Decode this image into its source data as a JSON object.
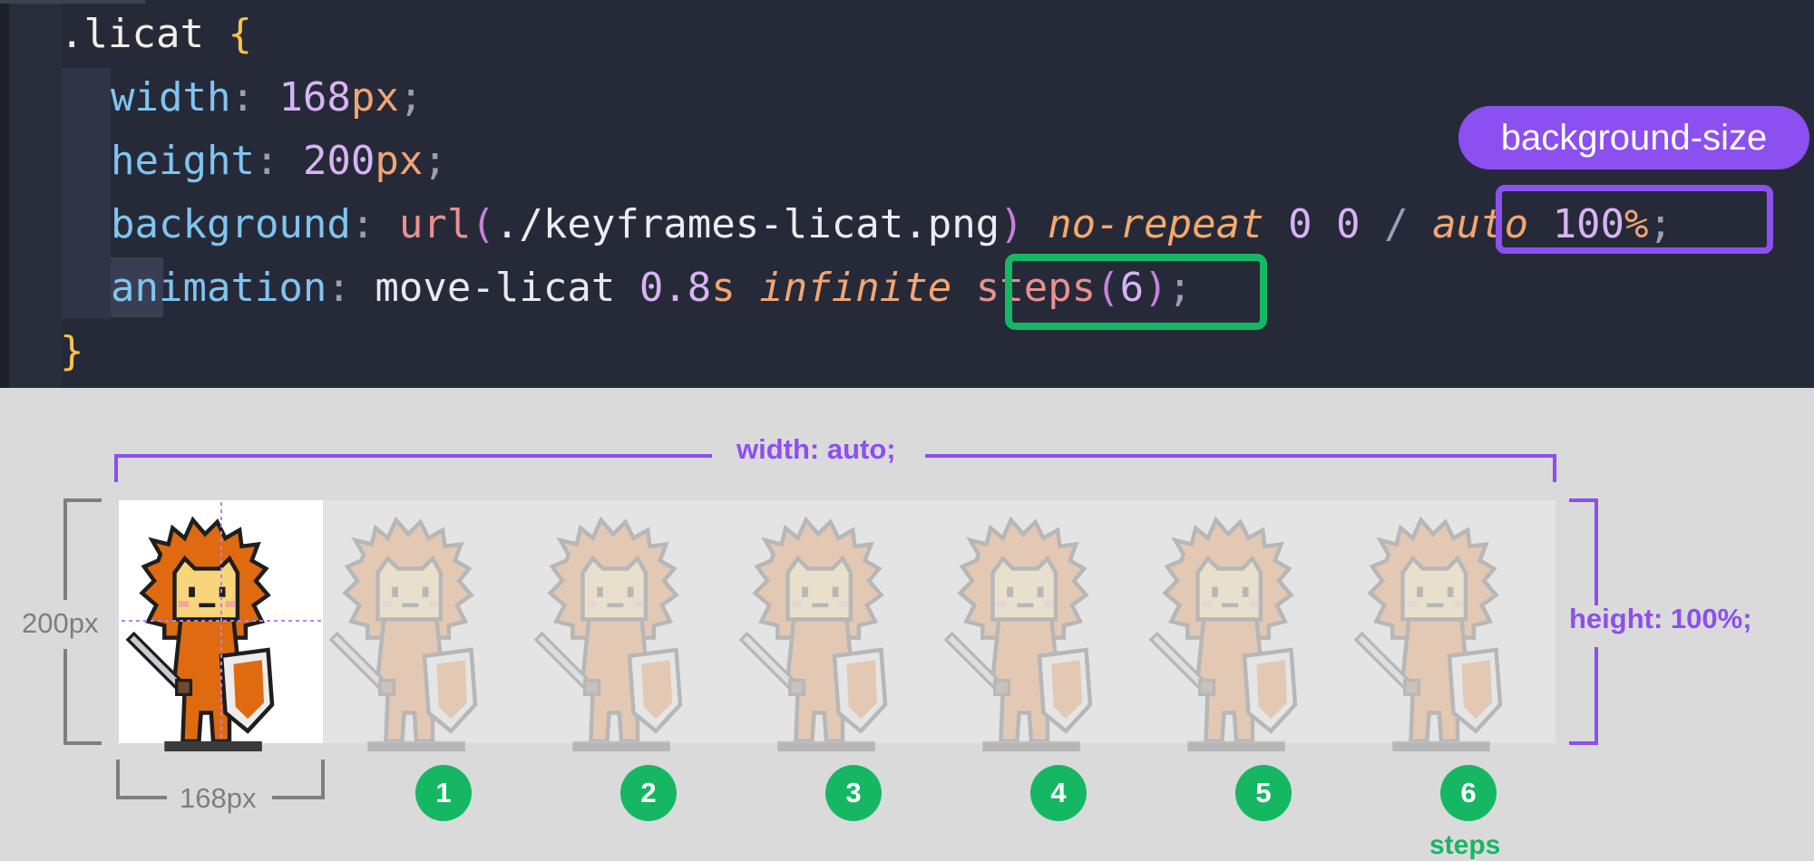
{
  "code": {
    "selector": ".licat",
    "open_brace": "{",
    "close_brace": "}",
    "lines": [
      {
        "prop": "width",
        "value_num": "168",
        "value_unit": "px"
      },
      {
        "prop": "height",
        "value_num": "200",
        "value_unit": "px"
      },
      {
        "prop": "background",
        "fn": "url",
        "arg": "./keyframes-licat.png",
        "repeat": "no-repeat",
        "pos_x": "0",
        "pos_y": "0",
        "slash": "/",
        "size_auto": "auto",
        "size_num": "100",
        "size_unit": "%"
      },
      {
        "prop": "animation",
        "name": "move-licat",
        "dur_num": "0.8",
        "dur_unit": "s",
        "iter": "infinite",
        "timing_fn": "steps",
        "timing_arg": "6"
      }
    ]
  },
  "callouts": {
    "background_size": "background-size"
  },
  "diagram": {
    "width_label": "width: auto;",
    "height_label": "height: 100%;",
    "frame_height_label": "200px",
    "frame_width_label": "168px",
    "step_numbers": [
      "1",
      "2",
      "3",
      "4",
      "5",
      "6"
    ],
    "steps_label": "steps"
  },
  "colors": {
    "purple": "#8c4ff0",
    "green": "#16b763",
    "editor_bg": "#262a38",
    "diagram_bg": "#dadada"
  },
  "icons": [
    "cat-sprite-icon",
    "sword-icon",
    "shield-icon"
  ]
}
